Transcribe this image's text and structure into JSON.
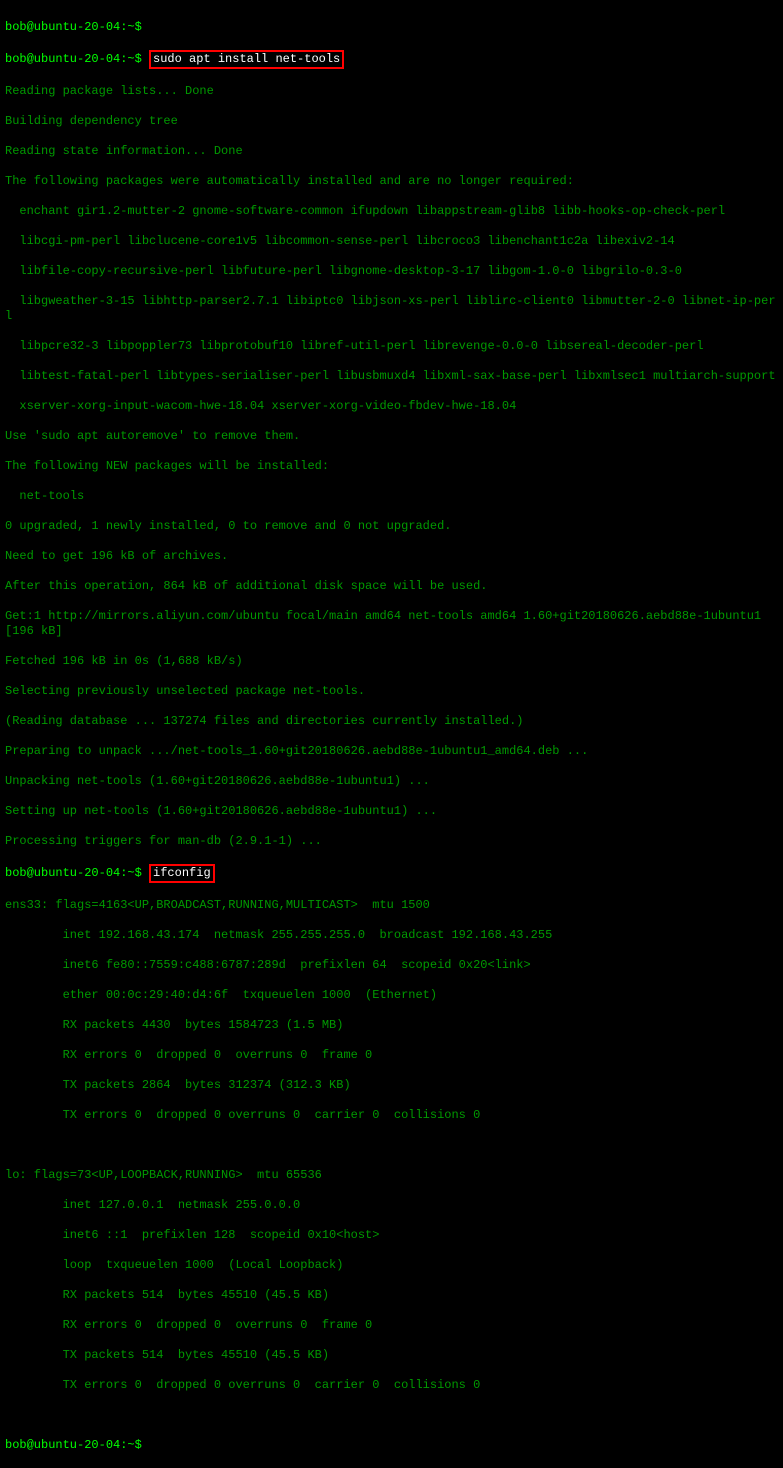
{
  "prompt1": "bob@ubuntu-20-04:~$ ",
  "prompt2": "bob@ubuntu-20-04:~$ ",
  "prompt3": "bob@ubuntu-20-04:~$ ",
  "prompt4": "bob@ubuntu-20-04:~$ ",
  "cmd1": "sudo apt install net-tools",
  "cmd2": "ifconfig",
  "apt": {
    "l1": "Reading package lists... Done",
    "l2": "Building dependency tree",
    "l3": "Reading state information... Done",
    "l4": "The following packages were automatically installed and are no longer required:",
    "l5": "  enchant gir1.2-mutter-2 gnome-software-common ifupdown libappstream-glib8 libb-hooks-op-check-perl",
    "l6": "  libcgi-pm-perl libclucene-core1v5 libcommon-sense-perl libcroco3 libenchant1c2a libexiv2-14",
    "l7": "  libfile-copy-recursive-perl libfuture-perl libgnome-desktop-3-17 libgom-1.0-0 libgrilo-0.3-0",
    "l8": "  libgweather-3-15 libhttp-parser2.7.1 libiptc0 libjson-xs-perl liblirc-client0 libmutter-2-0 libnet-ip-perl",
    "l9": "  libpcre32-3 libpoppler73 libprotobuf10 libref-util-perl librevenge-0.0-0 libsereal-decoder-perl",
    "l10": "  libtest-fatal-perl libtypes-serialiser-perl libusbmuxd4 libxml-sax-base-perl libxmlsec1 multiarch-support",
    "l11": "  xserver-xorg-input-wacom-hwe-18.04 xserver-xorg-video-fbdev-hwe-18.04",
    "l12": "Use 'sudo apt autoremove' to remove them.",
    "l13": "The following NEW packages will be installed:",
    "l14": "  net-tools",
    "l15": "0 upgraded, 1 newly installed, 0 to remove and 0 not upgraded.",
    "l16": "Need to get 196 kB of archives.",
    "l17": "After this operation, 864 kB of additional disk space will be used.",
    "l18": "Get:1 http://mirrors.aliyun.com/ubuntu focal/main amd64 net-tools amd64 1.60+git20180626.aebd88e-1ubuntu1 [196 kB]",
    "l19": "Fetched 196 kB in 0s (1,688 kB/s)",
    "l20": "Selecting previously unselected package net-tools.",
    "l21": "(Reading database ... 137274 files and directories currently installed.)",
    "l22": "Preparing to unpack .../net-tools_1.60+git20180626.aebd88e-1ubuntu1_amd64.deb ...",
    "l23": "Unpacking net-tools (1.60+git20180626.aebd88e-1ubuntu1) ...",
    "l24": "Setting up net-tools (1.60+git20180626.aebd88e-1ubuntu1) ...",
    "l25": "Processing triggers for man-db (2.9.1-1) ..."
  },
  "ifconfig": {
    "ens_header": "ens33: flags=4163<UP,BROADCAST,RUNNING,MULTICAST>  mtu 1500",
    "ens_inet": "        inet 192.168.43.174  netmask 255.255.255.0  broadcast 192.168.43.255",
    "ens_inet6": "        inet6 fe80::7559:c488:6787:289d  prefixlen 64  scopeid 0x20<link>",
    "ens_ether": "        ether 00:0c:29:40:d4:6f  txqueuelen 1000  (Ethernet)",
    "ens_rxp": "        RX packets 4430  bytes 1584723 (1.5 MB)",
    "ens_rxe": "        RX errors 0  dropped 0  overruns 0  frame 0",
    "ens_txp": "        TX packets 2864  bytes 312374 (312.3 KB)",
    "ens_txe": "        TX errors 0  dropped 0 overruns 0  carrier 0  collisions 0",
    "blank": "",
    "lo_header": "lo: flags=73<UP,LOOPBACK,RUNNING>  mtu 65536",
    "lo_inet": "        inet 127.0.0.1  netmask 255.0.0.0",
    "lo_inet6": "        inet6 ::1  prefixlen 128  scopeid 0x10<host>",
    "lo_loop": "        loop  txqueuelen 1000  (Local Loopback)",
    "lo_rxp": "        RX packets 514  bytes 45510 (45.5 KB)",
    "lo_rxe": "        RX errors 0  dropped 0  overruns 0  frame 0",
    "lo_txp": "        TX packets 514  bytes 45510 (45.5 KB)",
    "lo_txe": "        TX errors 0  dropped 0 overruns 0  carrier 0  collisions 0"
  }
}
